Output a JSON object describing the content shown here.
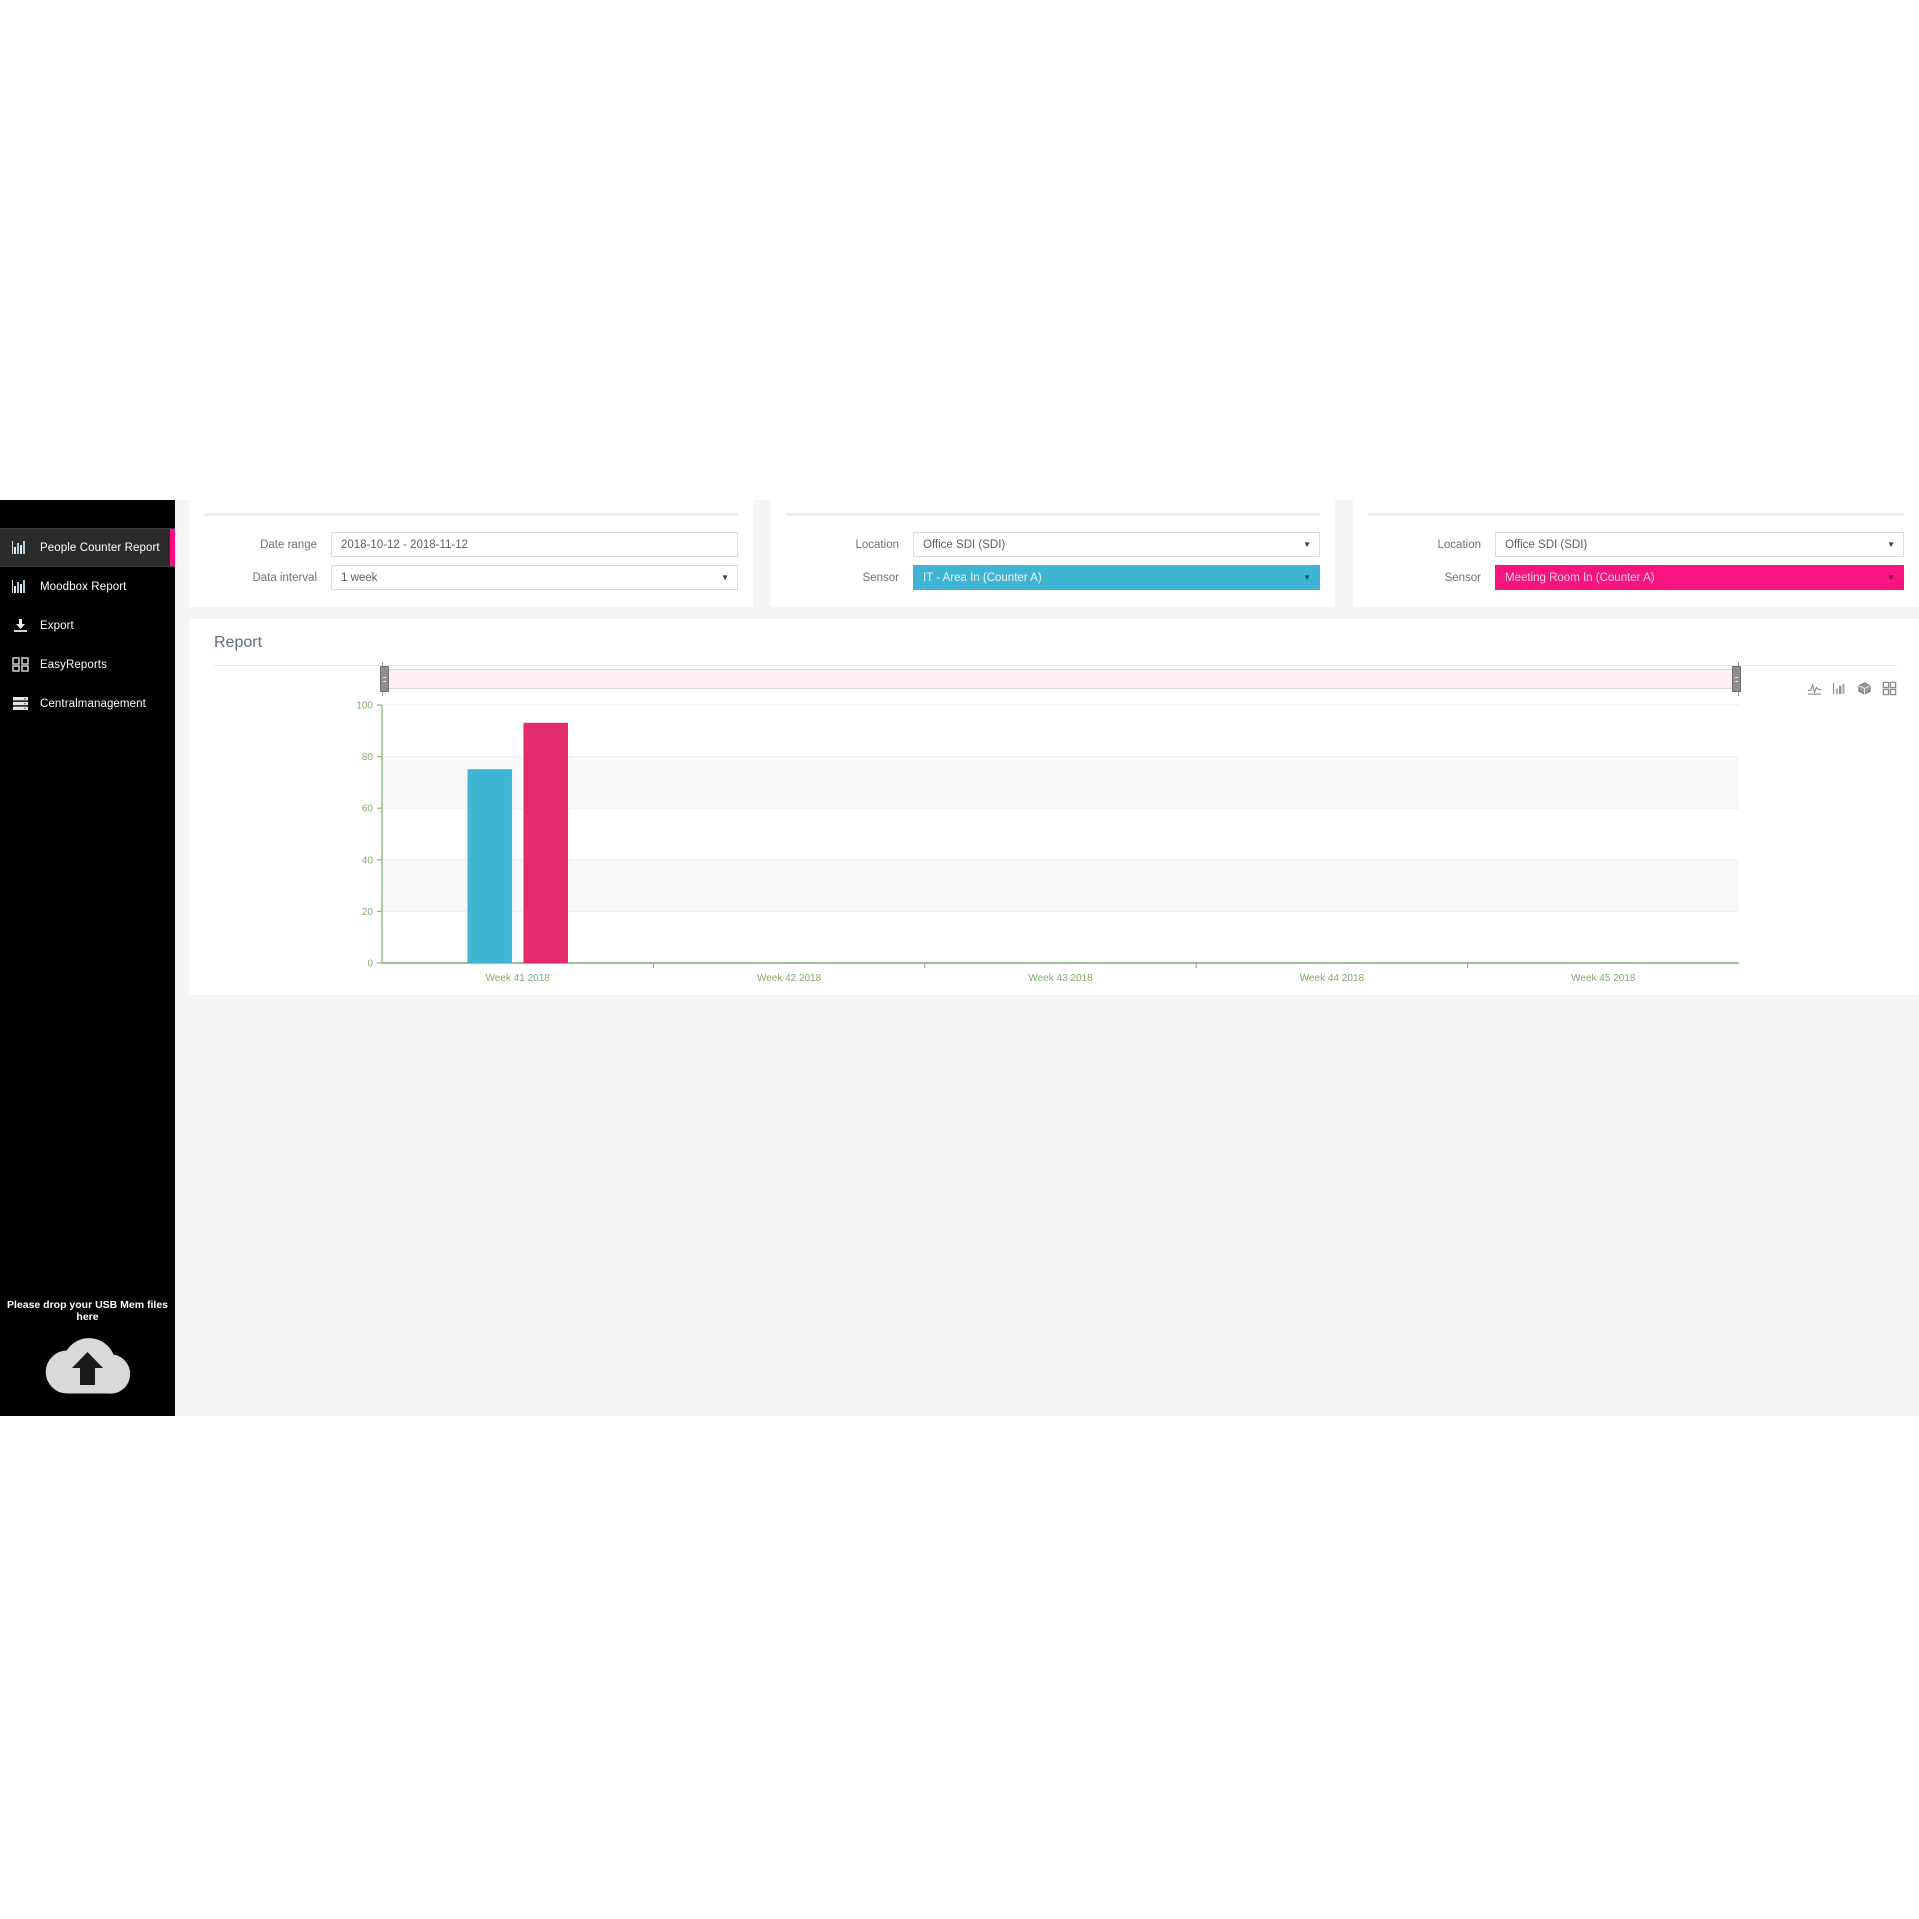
{
  "sidebar": {
    "items": [
      {
        "label": "People Counter Report",
        "icon": "bar-chart-icon",
        "active": true
      },
      {
        "label": "Moodbox Report",
        "icon": "bar-chart-icon",
        "active": false
      },
      {
        "label": "Export",
        "icon": "download-icon",
        "active": false
      },
      {
        "label": "EasyReports",
        "icon": "grid-squares-icon",
        "active": false
      },
      {
        "label": "Centralmanagement",
        "icon": "server-list-icon",
        "active": false
      }
    ],
    "dropzone": {
      "text": "Please drop your USB Mem files here",
      "icon": "cloud-upload-icon"
    },
    "active_marker_color": "#ff0c84"
  },
  "filters": {
    "panel1": {
      "date_range_label": "Date range",
      "date_range_value": "2018-10-12 - 2018-11-12",
      "data_interval_label": "Data interval",
      "data_interval_value": "1 week"
    },
    "panel2": {
      "location_label": "Location",
      "location_value": "Office SDI (SDI)",
      "sensor_label": "Sensor",
      "sensor_value": "IT - Area In (Counter A)",
      "sensor_color": "#40b5d3"
    },
    "panel3": {
      "location_label": "Location",
      "location_value": "Office SDI (SDI)",
      "sensor_label": "Sensor",
      "sensor_value": "Meeting Room In (Counter A)",
      "sensor_color": "#f7147f"
    }
  },
  "report": {
    "title": "Report",
    "toolbar_icons": [
      "line-chart-icon",
      "bar-chart-icon",
      "cube-3d-icon",
      "grid-view-icon"
    ]
  },
  "chart_data": {
    "type": "bar",
    "title": "",
    "xlabel": "",
    "ylabel": "",
    "categories": [
      "Week 41 2018",
      "Week 42 2018",
      "Week 43 2018",
      "Week 44 2018",
      "Week 45 2018"
    ],
    "ylim": [
      0,
      100
    ],
    "yticks": [
      0,
      20,
      40,
      60,
      80,
      100
    ],
    "grid": true,
    "legend_position": "none",
    "series": [
      {
        "name": "IT - Area In (Counter A)",
        "color": "#40b5d3",
        "values": [
          75,
          0,
          0,
          0,
          0
        ]
      },
      {
        "name": "Meeting Room In (Counter A)",
        "color": "#e22a6d",
        "values": [
          93,
          0,
          0,
          0,
          0
        ]
      }
    ]
  }
}
